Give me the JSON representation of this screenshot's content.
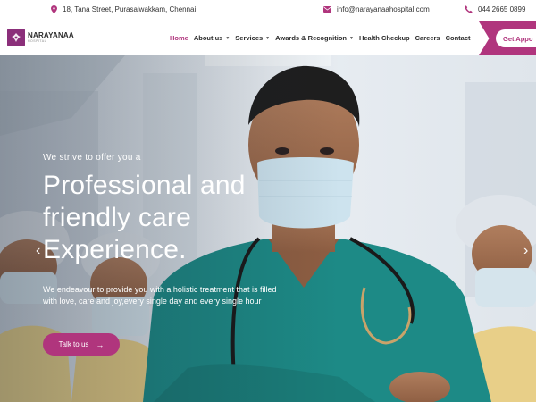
{
  "topbar": {
    "address": "18, Tana Street, Purasaiwakkam, Chennai",
    "email": "info@narayanaahospital.com",
    "phone": "044 2665 0899",
    "icon_color": "#b0357d"
  },
  "logo": {
    "name": "NARAYANAA",
    "sub": "HOSPITAL",
    "color": "#8b2f7a"
  },
  "nav": {
    "items": [
      {
        "label": "Home",
        "active": true,
        "dropdown": false
      },
      {
        "label": "About us",
        "active": false,
        "dropdown": true
      },
      {
        "label": "Services",
        "active": false,
        "dropdown": true
      },
      {
        "label": "Awards & Recognition",
        "active": false,
        "dropdown": true
      },
      {
        "label": "Health Checkup",
        "active": false,
        "dropdown": false
      },
      {
        "label": "Careers",
        "active": false,
        "dropdown": false
      },
      {
        "label": "Contact",
        "active": false,
        "dropdown": false
      }
    ],
    "cta_label": "Get Appo"
  },
  "hero": {
    "eyebrow": "We strive to offer you a",
    "headline_line1": "Professional and",
    "headline_line2": "friendly care",
    "headline_line3": "Experience.",
    "description": "We endeavour to provide you with a holistic treatment that is filled with love, care and joy,every single day and every single hour",
    "button_label": "Talk to us",
    "button_arrow": "→",
    "prev_arrow": "‹",
    "next_arrow": "›"
  },
  "colors": {
    "accent": "#b0357d",
    "scrub_teal": "#1d8a86",
    "text_dark": "#2b2b2b"
  }
}
